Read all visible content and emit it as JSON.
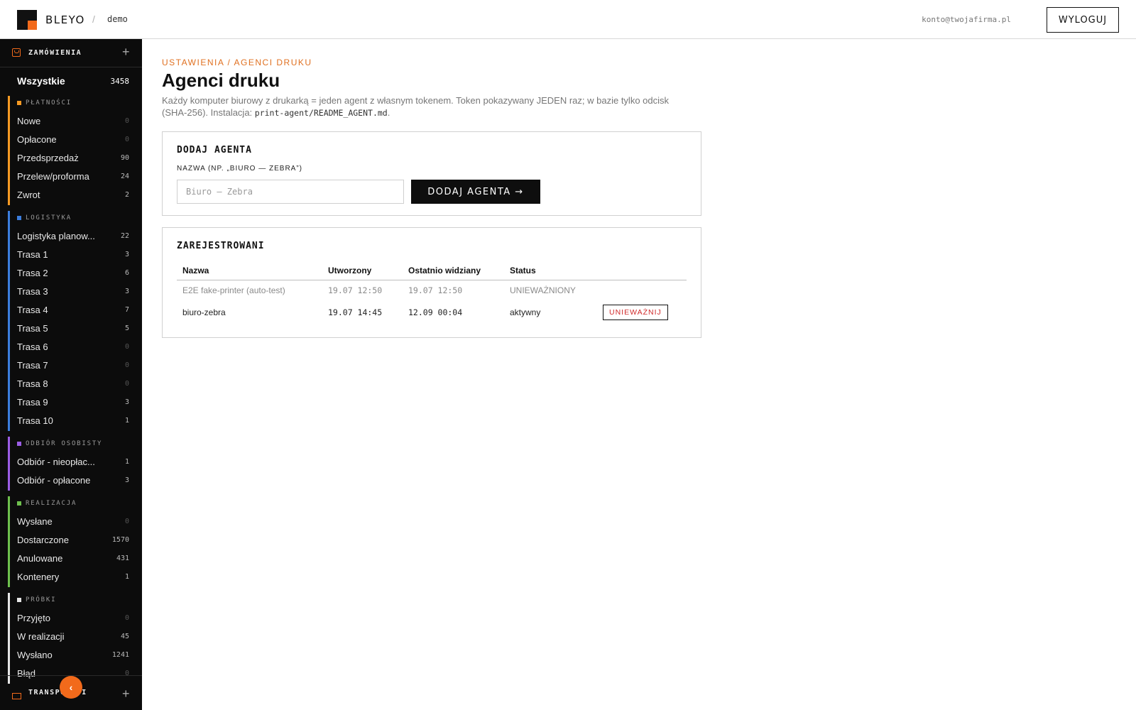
{
  "header": {
    "brand": "BLEYO",
    "separator": "/",
    "tenant": "demo",
    "account_email": "konto@twojafirma.pl",
    "logout_label": "WYLOGUJ"
  },
  "colors": {
    "accent": "#f26a1b",
    "sidebar_bg": "#0c0c0c",
    "platnosci": "#f59a23",
    "logistyka": "#3b7ddd",
    "odbior": "#9b5de5",
    "realizacja": "#6ec04d",
    "probki": "#e6e6e6",
    "revoke": "#d02a2a"
  },
  "sidebar": {
    "section_title": "ZAMÓWIENIA",
    "section_icon": "cart-icon",
    "add_label": "+",
    "all": {
      "label": "Wszystkie",
      "count": "3458"
    },
    "groups": [
      {
        "key": "platnosci",
        "title": "PŁATNOŚCI",
        "color": "#f59a23",
        "items": [
          {
            "label": "Nowe",
            "count": "0"
          },
          {
            "label": "Opłacone",
            "count": "0"
          },
          {
            "label": "Przedsprzedaż",
            "count": "90"
          },
          {
            "label": "Przelew/proforma",
            "count": "24"
          },
          {
            "label": "Zwrot",
            "count": "2"
          }
        ]
      },
      {
        "key": "logistyka",
        "title": "LOGISTYKA",
        "color": "#3b7ddd",
        "items": [
          {
            "label": "Logistyka planow...",
            "count": "22"
          },
          {
            "label": "Trasa 1",
            "count": "3"
          },
          {
            "label": "Trasa 2",
            "count": "6"
          },
          {
            "label": "Trasa 3",
            "count": "3"
          },
          {
            "label": "Trasa 4",
            "count": "7"
          },
          {
            "label": "Trasa 5",
            "count": "5"
          },
          {
            "label": "Trasa 6",
            "count": "0"
          },
          {
            "label": "Trasa 7",
            "count": "0"
          },
          {
            "label": "Trasa 8",
            "count": "0"
          },
          {
            "label": "Trasa 9",
            "count": "3"
          },
          {
            "label": "Trasa 10",
            "count": "1"
          }
        ]
      },
      {
        "key": "odbior",
        "title": "ODBIÓR OSOBISTY",
        "color": "#9b5de5",
        "items": [
          {
            "label": "Odbiór - nieopłac...",
            "count": "1"
          },
          {
            "label": "Odbiór - opłacone",
            "count": "3"
          }
        ]
      },
      {
        "key": "realizacja",
        "title": "REALIZACJA",
        "color": "#6ec04d",
        "items": [
          {
            "label": "Wysłane",
            "count": "0"
          },
          {
            "label": "Dostarczone",
            "count": "1570"
          },
          {
            "label": "Anulowane",
            "count": "431"
          },
          {
            "label": "Kontenery",
            "count": "1"
          }
        ]
      },
      {
        "key": "probki",
        "title": "PRÓBKI",
        "color": "#e6e6e6",
        "items": [
          {
            "label": "Przyjęto",
            "count": "0"
          },
          {
            "label": "W realizacji",
            "count": "45"
          },
          {
            "label": "Wysłano",
            "count": "1241"
          },
          {
            "label": "Błąd",
            "count": "0"
          }
        ]
      }
    ],
    "collapse_glyph": "‹",
    "next_section_title": "TRANSPORT I",
    "next_section_icon": "truck-icon"
  },
  "main": {
    "breadcrumb": "USTAWIENIA / AGENCI DRUKU",
    "title": "Agenci druku",
    "description_text": "Każdy komputer biurowy z drukarką = jeden agent z własnym tokenem. Token pokazywany JEDEN raz; w bazie tylko odcisk (SHA-256). Instalacja: ",
    "description_code": "print-agent/README_AGENT.md",
    "description_end": ".",
    "add_card": {
      "title": "DODAJ AGENTA",
      "field_label": "NAZWA (NP. „BIURO — ZEBRA”)",
      "input_value": "",
      "input_placeholder": "Biuro — Zebra",
      "button_label": "DODAJ AGENTA →"
    },
    "registered_card": {
      "title": "ZAREJESTROWANI",
      "columns": [
        "Nazwa",
        "Utworzony",
        "Ostatnio widziany",
        "Status"
      ],
      "rows": [
        {
          "name": "E2E fake-printer (auto-test)",
          "created": "19.07 12:50",
          "last_seen": "19.07 12:50",
          "status": "UNIEWAŻNIONY",
          "action": ""
        },
        {
          "name": "biuro-zebra",
          "created": "19.07 14:45",
          "last_seen": "12.09 00:04",
          "status": "aktywny",
          "action": "UNIEWAŻNIJ"
        }
      ]
    }
  }
}
